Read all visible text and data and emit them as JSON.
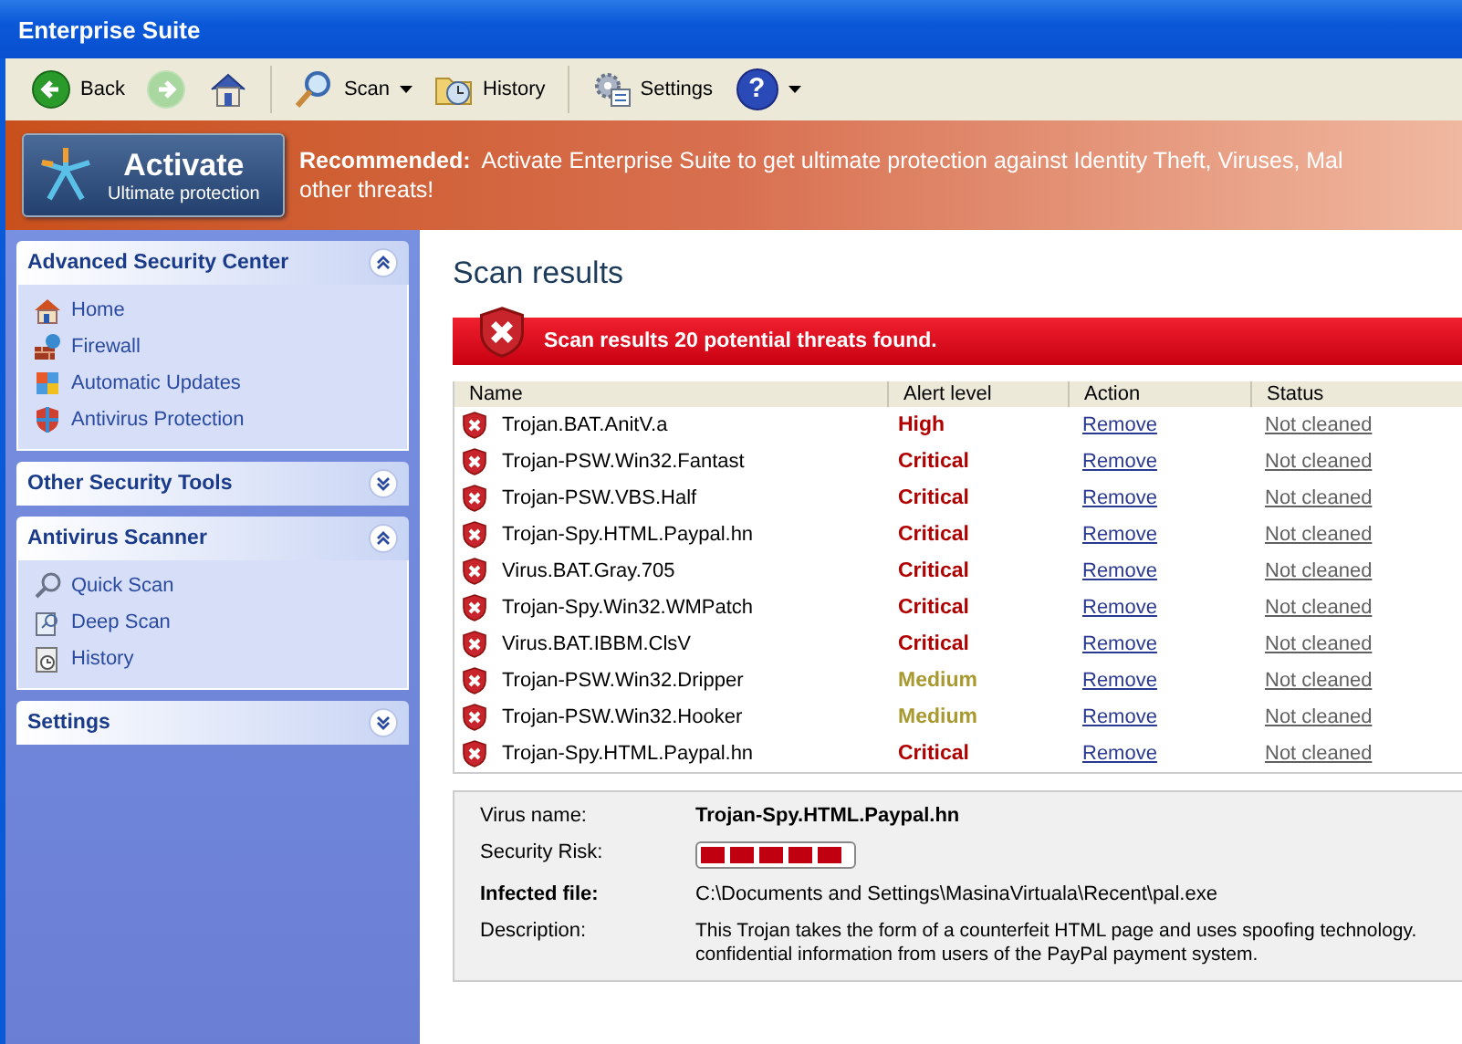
{
  "window": {
    "title": "Enterprise Suite"
  },
  "toolbar": [
    {
      "kind": "back",
      "label": "Back",
      "disabled": false
    },
    {
      "kind": "forward",
      "disabled": true
    },
    {
      "kind": "home"
    },
    {
      "kind": "scan",
      "label": "Scan",
      "dropdown": true
    },
    {
      "kind": "history",
      "label": "History",
      "dropdown": false
    },
    {
      "kind": "settings",
      "label": "Settings",
      "dropdown": false
    },
    {
      "kind": "help",
      "glyph": "?",
      "dropdown": true
    }
  ],
  "banner": {
    "button_title": "Activate",
    "button_subtitle": "Ultimate protection",
    "heading": "Recommended:",
    "message_lines": [
      "Activate Enterprise Suite to get ultimate protection against Identity Theft, Viruses, Mal",
      "other threats!"
    ]
  },
  "sidebar": {
    "panels": [
      {
        "title": "Advanced Security Center",
        "expanded": true,
        "items": [
          {
            "kind": "home",
            "label": "Home"
          },
          {
            "kind": "firewall",
            "label": "Firewall"
          },
          {
            "kind": "updates",
            "label": "Automatic Updates"
          },
          {
            "kind": "shield",
            "label": "Antivirus Protection"
          }
        ]
      },
      {
        "title": "Other Security Tools",
        "expanded": false
      },
      {
        "title": "Antivirus Scanner",
        "expanded": true,
        "items": [
          {
            "kind": "search",
            "label": "Quick Scan"
          },
          {
            "kind": "deep",
            "label": "Deep Scan"
          },
          {
            "kind": "history",
            "label": "History"
          }
        ]
      },
      {
        "title": "Settings",
        "expanded": false
      }
    ]
  },
  "main": {
    "heading": "Scan results",
    "alert": "Scan results 20 potential threats found.",
    "table": {
      "columns": [
        "Name",
        "Alert level",
        "Action",
        "Status"
      ],
      "rows": [
        {
          "name": "Trojan.BAT.AnitV.a",
          "alert_level": "High",
          "color": "#b00000",
          "action": "Remove",
          "status": "Not cleaned"
        },
        {
          "name": "Trojan-PSW.Win32.Fantast",
          "alert_level": "Critical",
          "color": "#b00000",
          "action": "Remove",
          "status": "Not cleaned"
        },
        {
          "name": "Trojan-PSW.VBS.Half",
          "alert_level": "Critical",
          "color": "#b00000",
          "action": "Remove",
          "status": "Not cleaned"
        },
        {
          "name": "Trojan-Spy.HTML.Paypal.hn",
          "alert_level": "Critical",
          "color": "#b00000",
          "action": "Remove",
          "status": "Not cleaned"
        },
        {
          "name": "Virus.BAT.Gray.705",
          "alert_level": "Critical",
          "color": "#b00000",
          "action": "Remove",
          "status": "Not cleaned"
        },
        {
          "name": "Trojan-Spy.Win32.WMPatch",
          "alert_level": "Critical",
          "color": "#b00000",
          "action": "Remove",
          "status": "Not cleaned"
        },
        {
          "name": "Virus.BAT.IBBM.ClsV",
          "alert_level": "Critical",
          "color": "#b00000",
          "action": "Remove",
          "status": "Not cleaned"
        },
        {
          "name": "Trojan-PSW.Win32.Dripper",
          "alert_level": "Medium",
          "color": "#a89a30",
          "action": "Remove",
          "status": "Not cleaned"
        },
        {
          "name": "Trojan-PSW.Win32.Hooker",
          "alert_level": "Medium",
          "color": "#a89a30",
          "action": "Remove",
          "status": "Not cleaned"
        },
        {
          "name": "Trojan-Spy.HTML.Paypal.hn",
          "alert_level": "Critical",
          "color": "#b00000",
          "action": "Remove",
          "status": "Not cleaned"
        }
      ]
    },
    "details": {
      "virus_name_label": "Virus name:",
      "virus_name": "Trojan-Spy.HTML.Paypal.hn",
      "risk_label": "Security Risk:",
      "risk": {
        "level": 1
      },
      "file_label": "Infected file:",
      "file": "C:\\Documents and Settings\\MasinaVirtuala\\Recent\\pal.exe",
      "description_label": "Description:",
      "description_lines": [
        "This Trojan takes the form of a counterfeit HTML page and uses spoofing technology.",
        "confidential information from users of the PayPal payment system."
      ]
    }
  }
}
